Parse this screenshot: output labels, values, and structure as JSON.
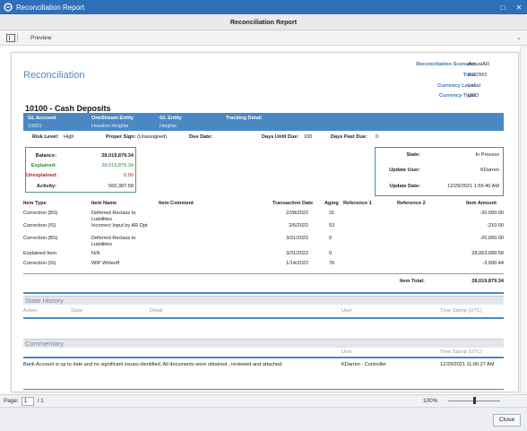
{
  "window": {
    "title": "Reconciliation Report"
  },
  "header": {
    "title": "Reconciliation Report"
  },
  "toolbar": {
    "preview_label": "Preview"
  },
  "report": {
    "title": "Reconciliation",
    "meta": [
      {
        "label": "Reconciliation Scenario:",
        "value": "ActualAR"
      },
      {
        "label": "Time:",
        "value": "2022M3"
      },
      {
        "label": "Currency Level:",
        "value": "Local"
      },
      {
        "label": "Currency Type:",
        "value": "USD"
      }
    ],
    "section_title": "10100 - Cash Deposits",
    "band": {
      "gl_account_label": "GL Account",
      "gl_account_value": "10001",
      "entity_label": "OneStream Entity",
      "entity_value": "Houston Heights",
      "gl_entity_label": "GL Entity",
      "gl_entity_value": "Heights",
      "tracking_label": "Tracking Detail"
    },
    "risk": {
      "risk_label": "Risk Level:",
      "risk_value": "High",
      "sign_label": "Proper Sign:",
      "sign_value": "(Unassigned)",
      "due_label": "Due Date:",
      "due_value": "",
      "days_until_label": "Days Until Due:",
      "days_until_value": "100",
      "days_past_label": "Days Past Due:",
      "days_past_value": "0"
    },
    "balance": {
      "balance_label": "Balance:",
      "balance_value": "28,019,879.34",
      "explained_label": "Explained:",
      "explained_value": "28,019,879.34",
      "unexplained_label": "Unexplained:",
      "unexplained_value": "0.00",
      "activity_label": "Activity:",
      "activity_value": "560,387.58"
    },
    "state": {
      "state_label": "State:",
      "state_value": "In Process",
      "user_label": "Update User:",
      "user_value": "KDarren",
      "date_label": "Update Date:",
      "date_value": "12/29/2021 1:55:40 AM"
    },
    "transactions": {
      "headers": {
        "item_type": "Item Type",
        "item_name": "Item Name",
        "item_comment": "Item Comment",
        "transaction_date": "Transaction Date",
        "aging": "Aging",
        "reference1": "Reference 1",
        "reference2": "Reference 2",
        "item_amount": "Item Amount"
      },
      "rows": [
        {
          "type": "Correction (BS)",
          "name": "Deferred Reclass to Liabilities",
          "comment": "",
          "date": "2/28/2022",
          "aging": "31",
          "ref1": "",
          "ref2": "",
          "amount": "-20,000.00"
        },
        {
          "type": "Correction (IS)",
          "name": "Incorrect Input by AR Dpt",
          "comment": "",
          "date": "2/6/2022",
          "aging": "53",
          "ref1": "",
          "ref2": "",
          "amount": "-210.00"
        },
        {
          "type": "Correction (BS)",
          "name": "Deferred Reclass to Liabilities",
          "comment": "",
          "date": "3/31/2022",
          "aging": "0",
          "ref1": "",
          "ref2": "",
          "amount": "-20,000.00"
        },
        {
          "type": "Explained Item",
          "name": "N/A",
          "comment": "",
          "date": "3/31/2022",
          "aging": "0",
          "ref1": "",
          "ref2": "",
          "amount": "28,063,089.58"
        },
        {
          "type": "Correction (IS)",
          "name": "WIP Writeoff",
          "comment": "",
          "date": "1/14/2022",
          "aging": "76",
          "ref1": "",
          "ref2": "",
          "amount": "-3,000.44"
        }
      ],
      "total_label": "Item Total:",
      "total_value": "28,019,879.34"
    },
    "state_history": {
      "title": "State History",
      "headers": {
        "action": "Action",
        "state": "State",
        "detail": "Detail",
        "user": "User",
        "time": "Time Stamp (UTC)"
      }
    },
    "commentary": {
      "title": "Commentary",
      "headers": {
        "user": "User",
        "time": "Time Stamp (UTC)"
      },
      "text": "Bank Account is up to date and no significant issues identified. All documents were obtained , reviewed and attached.",
      "user": "KDarren - Controller",
      "time": "12/29/2021 11:06:27 AM"
    }
  },
  "status": {
    "page_label": "Page:",
    "page_value": "1",
    "page_of": "/ 1",
    "zoom": "100%",
    "zoom_level_percent": 100
  },
  "footer": {
    "close_label": "Close"
  },
  "colors": {
    "titlebar": "#2e6fb7",
    "accent": "#4a88c4",
    "explained_green": "#2f8a3a",
    "unexplained_red": "#b32222"
  }
}
